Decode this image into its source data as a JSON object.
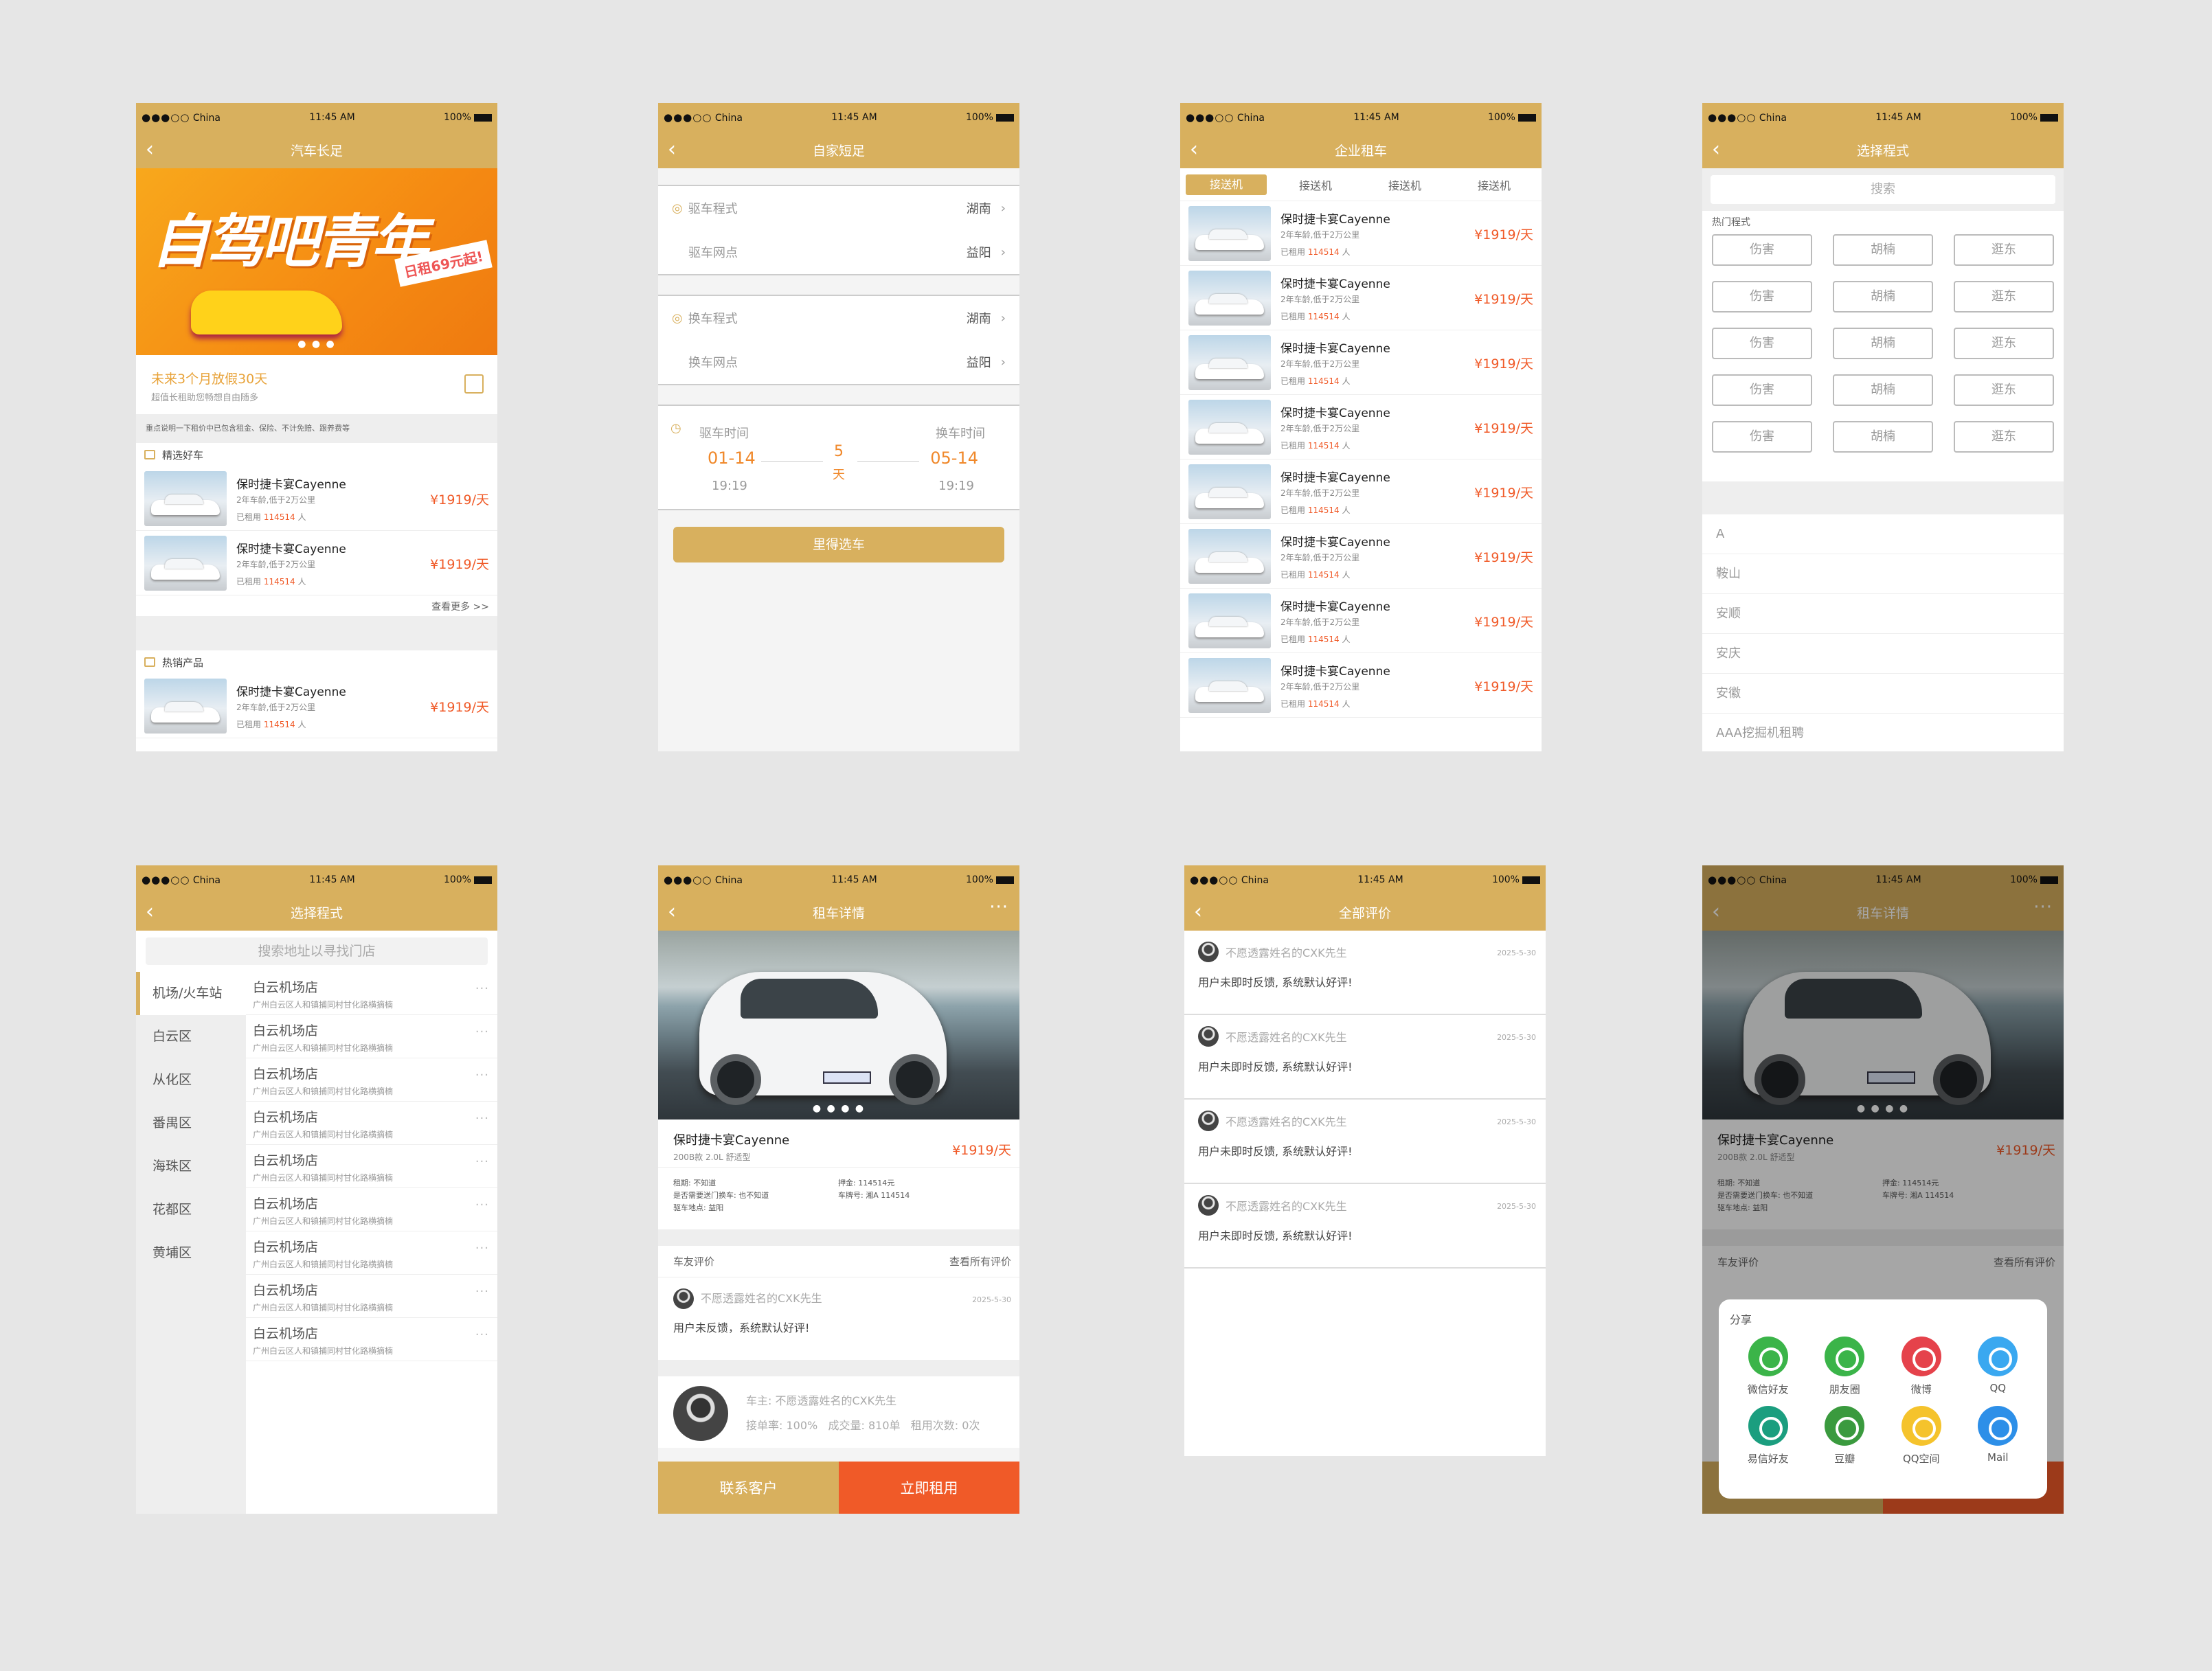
{
  "status": {
    "carrier": "China",
    "time": "11:45 AM",
    "battery": "100%"
  },
  "s1": {
    "title": "汽车长足",
    "banner": {
      "headline": "自驾吧青年",
      "tag": "日租69元起!"
    },
    "promo": {
      "title": "未来3个月放假30天",
      "sub": "超值长租助您畅想自由随多"
    },
    "note": "重点说明一下租价中已包含租金、保险、不计免赔、跟养费等",
    "sec1": "精选好车",
    "sec2": "热销产品",
    "more": "查看更多 >>",
    "cars": [
      {
        "name": "保时捷卡宴Cayenne",
        "spec": "2年车龄,低于2万公里",
        "rented_prefix": "已租用",
        "rented": "114514",
        "unit": "人",
        "price": "¥1919/天"
      }
    ]
  },
  "s2": {
    "title": "自家短足",
    "pick_city_label": "驱车程式",
    "pick_city": "湖南",
    "pick_point_label": "驱车网点",
    "pick_point": "益阳",
    "ret_city_label": "换车程式",
    "ret_city": "湖南",
    "ret_point_label": "换车网点",
    "ret_point": "益阳",
    "pick_time_label": "驱车时间",
    "ret_time_label": "换车时间",
    "pick_date": "01-14",
    "pick_hour": "19:19",
    "ret_date": "05-14",
    "ret_hour": "19:19",
    "days": "5",
    "days_unit": "天",
    "button": "里得选车"
  },
  "s3": {
    "title": "企业租车",
    "tabs": [
      "接送机",
      "接送机",
      "接送机",
      "接送机"
    ]
  },
  "s4": {
    "title": "选择程式",
    "search": "搜索",
    "hot": "热门程式",
    "grid": [
      [
        "伤害",
        "胡楠",
        "逛东"
      ],
      [
        "伤害",
        "胡楠",
        "逛东"
      ],
      [
        "伤害",
        "胡楠",
        "逛东"
      ],
      [
        "伤害",
        "胡楠",
        "逛东"
      ],
      [
        "伤害",
        "胡楠",
        "逛东"
      ]
    ],
    "list": [
      "A",
      "鞍山",
      "安顺",
      "安庆",
      "安徽",
      "AAA挖掘机租聘"
    ]
  },
  "s5": {
    "title": "选择程式",
    "search": "搜索地址以寻找门店",
    "districts": [
      "机场/火车站",
      "白云区",
      "从化区",
      "番禺区",
      "海珠区",
      "花都区",
      "黄埔区"
    ],
    "store_name": "白云机场店",
    "store_addr": "广州白云区人和镇捕同村甘化路横摘楠"
  },
  "s6": {
    "title": "租车详情",
    "car": "保时捷卡宴Cayenne",
    "spec": "200B款 2.0L 舒适型",
    "price": "¥1919/天",
    "info": {
      "l1": "租期: 不知道",
      "l2": "是否需要送门换车: 也不知道",
      "l3": "驱车地点: 益阳",
      "r1": "押金: 114514元",
      "r2": "车牌号: 湘A 114514"
    },
    "reviews_label": "车友评价",
    "reviews_all": "查看所有评价",
    "rev_user": "不愿透露姓名的CXK先生",
    "rev_date": "2025-5-30",
    "rev_text": "用户未反馈，系统默认好评!",
    "owner": "车主: 不愿透露姓名的CXK先生",
    "owner_stats": "接单率: 100%   成交量: 810单   租用次数: 0次",
    "contact": "联系客户",
    "rent": "立即租用"
  },
  "s7": {
    "title": "全部评价",
    "user": "不愿透露姓名的CXK先生",
    "date": "2025-5-30",
    "text": "用户未即时反馈, 系统默认好评!"
  },
  "s8": {
    "share": "分享",
    "items": [
      {
        "label": "微信好友",
        "color": "#3bb449"
      },
      {
        "label": "朋友圈",
        "color": "#3bb449"
      },
      {
        "label": "微博",
        "color": "#e5424b"
      },
      {
        "label": "QQ",
        "color": "#3aa8f0"
      },
      {
        "label": "易信好友",
        "color": "#1b9e7f"
      },
      {
        "label": "豆瓣",
        "color": "#3a9a3e"
      },
      {
        "label": "QQ空间",
        "color": "#f5c32c"
      },
      {
        "label": "Mail",
        "color": "#2d8fe8"
      }
    ]
  },
  "colors": {
    "gold": "#d8b05e",
    "orange": "#f05a28"
  }
}
